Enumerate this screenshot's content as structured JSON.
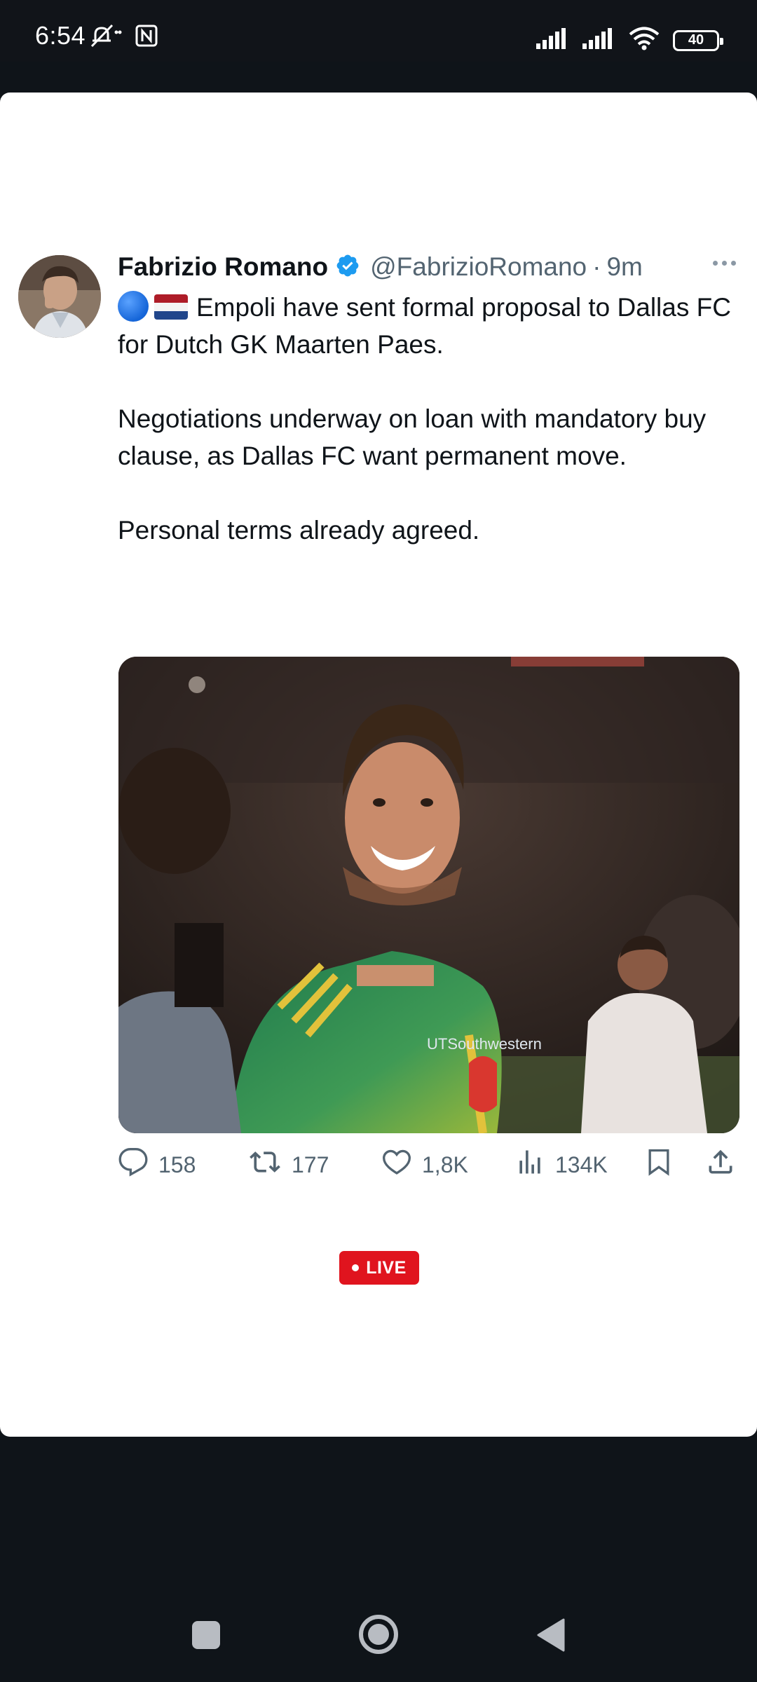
{
  "status_bar": {
    "time": "6:54",
    "battery": "40",
    "icons": [
      "mute-icon",
      "nfc-icon",
      "signal-icon",
      "signal-icon",
      "wifi-icon",
      "battery-icon"
    ]
  },
  "tweet": {
    "author_name": "Fabrizio Romano",
    "handle": "@FabrizioRomano",
    "separator": "·",
    "time": "9m",
    "text_line1": "Empoli have sent formal proposal to Dallas FC for Dutch GK Maarten Paes.",
    "text_para2": "Negotiations underway on loan with mandatory buy clause, as Dallas FC want permanent move.",
    "text_para3": "Personal terms already agreed.",
    "media_sponsor_text": "UTSouthwestern",
    "actions": {
      "replies": "158",
      "retweets": "177",
      "likes": "1,8K",
      "views": "134K"
    }
  },
  "live_badge": "LIVE",
  "colors": {
    "background": "#0f1419",
    "card": "#ffffff",
    "text": "#0f1419",
    "secondary": "#536471",
    "verified": "#1d9bf0",
    "live": "#e0141e"
  }
}
